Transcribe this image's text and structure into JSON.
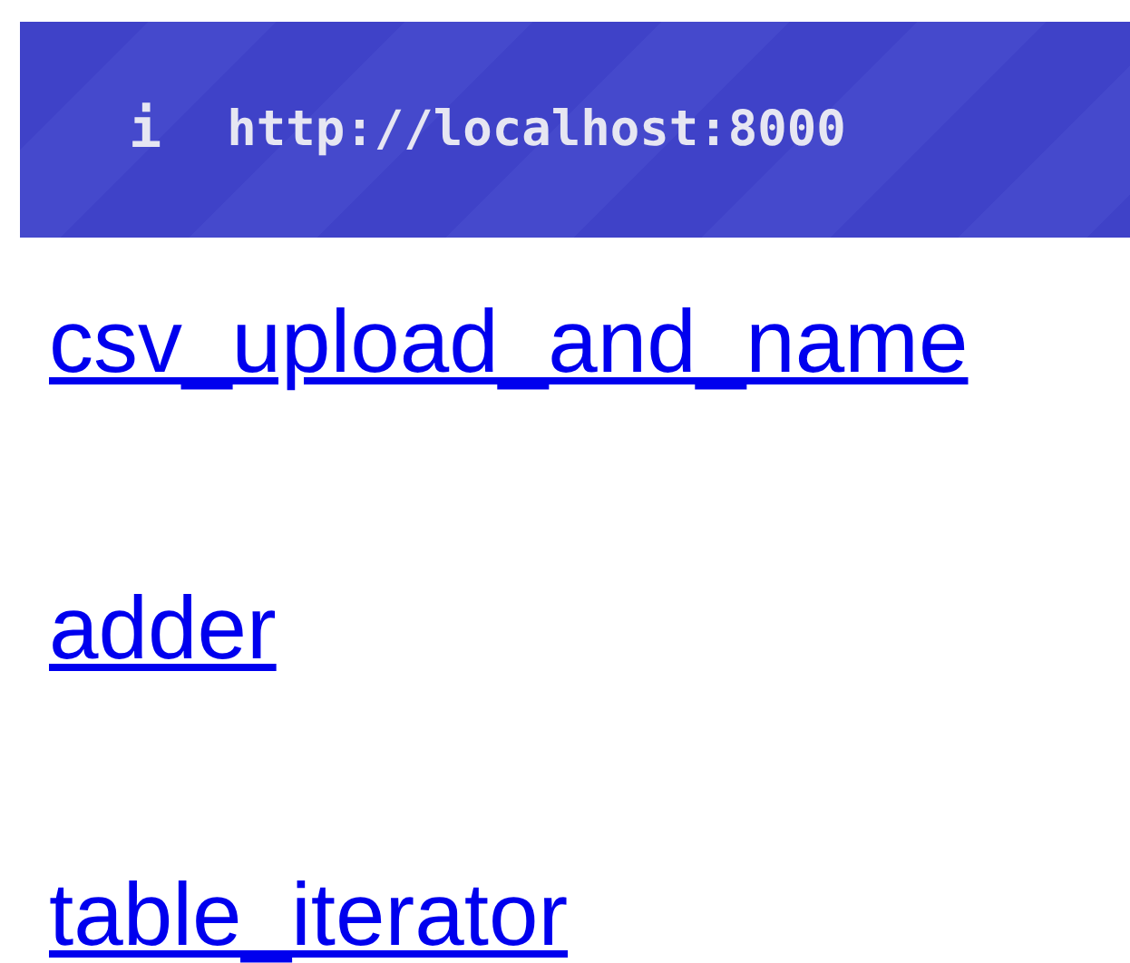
{
  "banner": {
    "icon_glyph": "i",
    "url": "http://localhost:8000"
  },
  "links": [
    {
      "label": "csv_upload_and_name"
    },
    {
      "label": "adder"
    },
    {
      "label": "table_iterator"
    }
  ]
}
